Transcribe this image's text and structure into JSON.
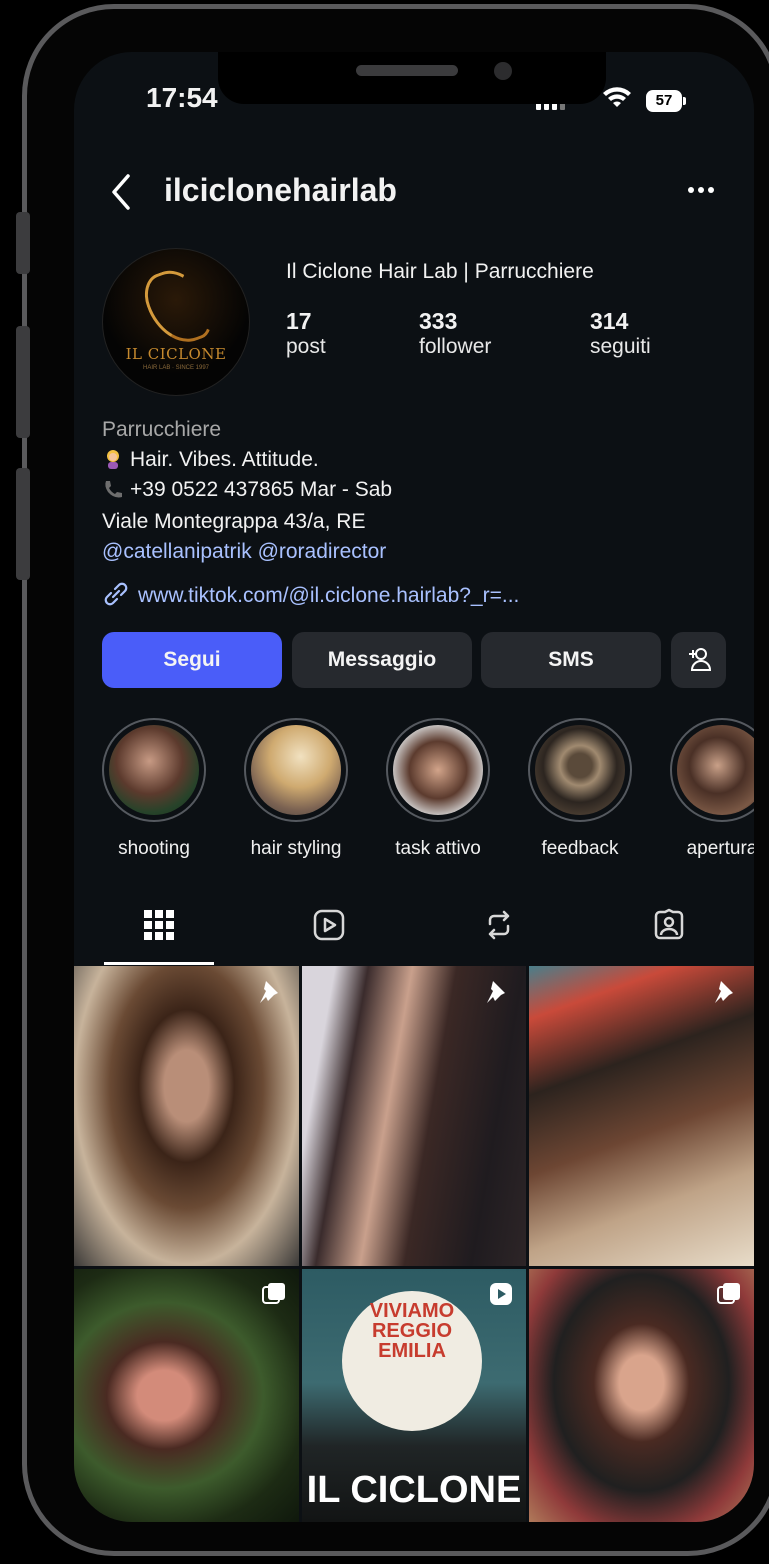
{
  "status": {
    "time": "17:54",
    "battery": "57"
  },
  "header": {
    "username": "ilciclonehairlab",
    "back_icon": "chevron-left-icon",
    "more_icon": "ellipsis-icon"
  },
  "profile": {
    "display_name": "Il Ciclone Hair Lab | Parrucchiere",
    "avatar": {
      "text": "IL CICLONE",
      "subtext": "HAIR LAB · SINCE 1997"
    },
    "stats": [
      {
        "value": "17",
        "label": "post"
      },
      {
        "value": "333",
        "label": "follower"
      },
      {
        "value": "314",
        "label": "seguiti"
      }
    ],
    "bio": {
      "category": "Parrucchiere",
      "line1": "Hair. Vibes. Attitude.",
      "line2": "+39 0522 437865  Mar - Sab",
      "line3": "Viale Montegrappa 43/a, RE",
      "mention1": "@catellanipatrik",
      "mention2": "@roradirector",
      "link": "www.tiktok.com/@il.ciclone.hairlab?_r=..."
    }
  },
  "actions": {
    "follow": "Segui",
    "message": "Messaggio",
    "sms": "SMS",
    "add_user_icon": "person-plus-icon"
  },
  "highlights": [
    {
      "label": "shooting"
    },
    {
      "label": "hair styling"
    },
    {
      "label": "task attivo"
    },
    {
      "label": "feedback"
    },
    {
      "label": "apertura"
    }
  ],
  "tabs": [
    "grid-icon",
    "reels-icon",
    "repost-icon",
    "tagged-icon"
  ],
  "posts": [
    {
      "type": "pinned"
    },
    {
      "type": "pinned"
    },
    {
      "type": "pinned"
    },
    {
      "type": "carousel"
    },
    {
      "type": "reel",
      "text_top1": "VIVIAMO",
      "text_top2": "REGGIO",
      "text_top3": "EMILIA",
      "text_bottom": "IL CICLONE"
    },
    {
      "type": "carousel"
    }
  ],
  "colors": {
    "background": "#0c1014",
    "follow_button": "#4a5df9",
    "link": "#a9c1ff",
    "secondary_button": "#26292e"
  }
}
